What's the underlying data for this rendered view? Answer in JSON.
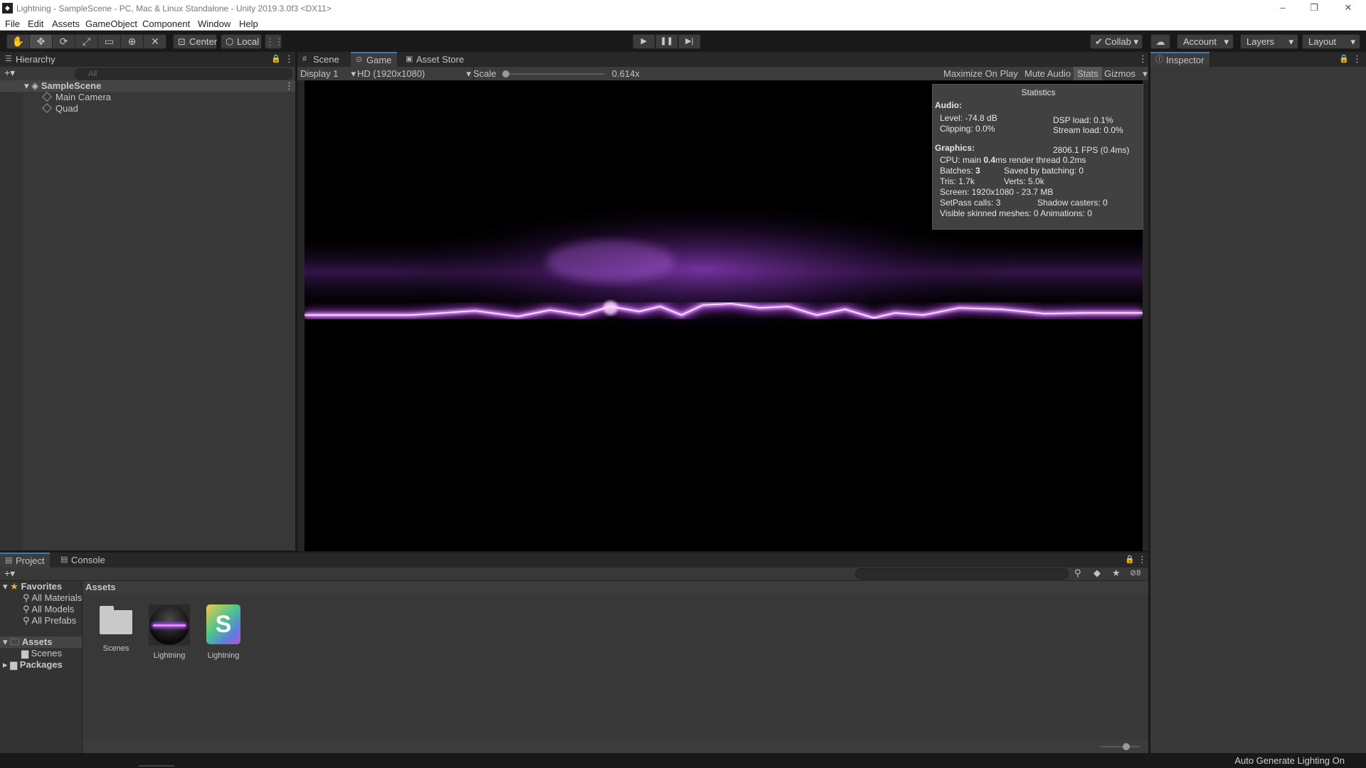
{
  "window": {
    "title": "Lightning - SampleScene - PC, Mac & Linux Standalone - Unity 2019.3.0f3 <DX11>",
    "logo": "unity-logo-icon",
    "controls": [
      "minimize-icon",
      "restore-icon",
      "close-icon"
    ]
  },
  "menu": [
    "File",
    "Edit",
    "Assets",
    "GameObject",
    "Component",
    "Window",
    "Help"
  ],
  "toolbar": {
    "tools": [
      "hand-tool-icon",
      "move-tool-icon",
      "rotate-tool-icon",
      "scale-tool-icon",
      "rect-tool-icon",
      "transform-tool-icon",
      "custom-tool-icon"
    ],
    "pivot": "Center",
    "space": "Local",
    "snap_icon": "grid-snap-icon",
    "play": [
      "play-icon",
      "pause-icon",
      "step-icon"
    ],
    "collab": "Collab",
    "cloud_icon": "cloud-icon",
    "account": "Account",
    "layers": "Layers",
    "layout": "Layout"
  },
  "hierarchy": {
    "tab": "Hierarchy",
    "search_placeholder": "All",
    "scene": "SampleScene",
    "items": [
      "Main Camera",
      "Quad"
    ]
  },
  "center_tabs": [
    "Scene",
    "Game",
    "Asset Store"
  ],
  "game_bar": {
    "display": "Display 1",
    "resolution": "HD (1920x1080)",
    "scale_label": "Scale",
    "scale_value": "0.614x",
    "scale_fraction": 0.0,
    "maximize": "Maximize On Play",
    "mute": "Mute Audio",
    "stats": "Stats",
    "gizmos": "Gizmos"
  },
  "stats": {
    "title": "Statistics",
    "audio_label": "Audio:",
    "level": "Level: -74.8 dB",
    "dsp": "DSP load: 0.1%",
    "clipping": "Clipping: 0.0%",
    "stream": "Stream load: 0.0%",
    "graphics_label": "Graphics:",
    "fps": "2806.1 FPS (0.4ms)",
    "cpu_pre": "CPU: main ",
    "cpu_bold": "0.4",
    "cpu_post": "ms  render thread 0.2ms",
    "batches_pre": "Batches: ",
    "batches_bold": "3",
    "saved": "Saved by batching: 0",
    "tris": "Tris: 1.7k",
    "verts": "Verts: 5.0k",
    "screen": "Screen: 1920x1080 - 23.7 MB",
    "setpass": "SetPass calls: 3",
    "shadow": "Shadow casters: 0",
    "skinned": "Visible skinned meshes: 0  Animations: 0"
  },
  "inspector": {
    "tab": "Inspector"
  },
  "project": {
    "tabs": [
      "Project",
      "Console"
    ],
    "favorites_label": "Favorites",
    "favorites": [
      "All Materials",
      "All Models",
      "All Prefabs"
    ],
    "assets_label": "Assets",
    "asset_children": [
      "Scenes"
    ],
    "packages_label": "Packages",
    "breadcrumb": "Assets",
    "hidden_count": "8",
    "assets": [
      {
        "name": "Scenes",
        "kind": "folder"
      },
      {
        "name": "Lightning",
        "kind": "material"
      },
      {
        "name": "Lightning",
        "kind": "shader"
      }
    ]
  },
  "status": {
    "text": "Auto Generate Lighting On"
  },
  "colors": {
    "accent": "#3a79bb",
    "lightning": "#d36bff",
    "panel": "#383838"
  }
}
